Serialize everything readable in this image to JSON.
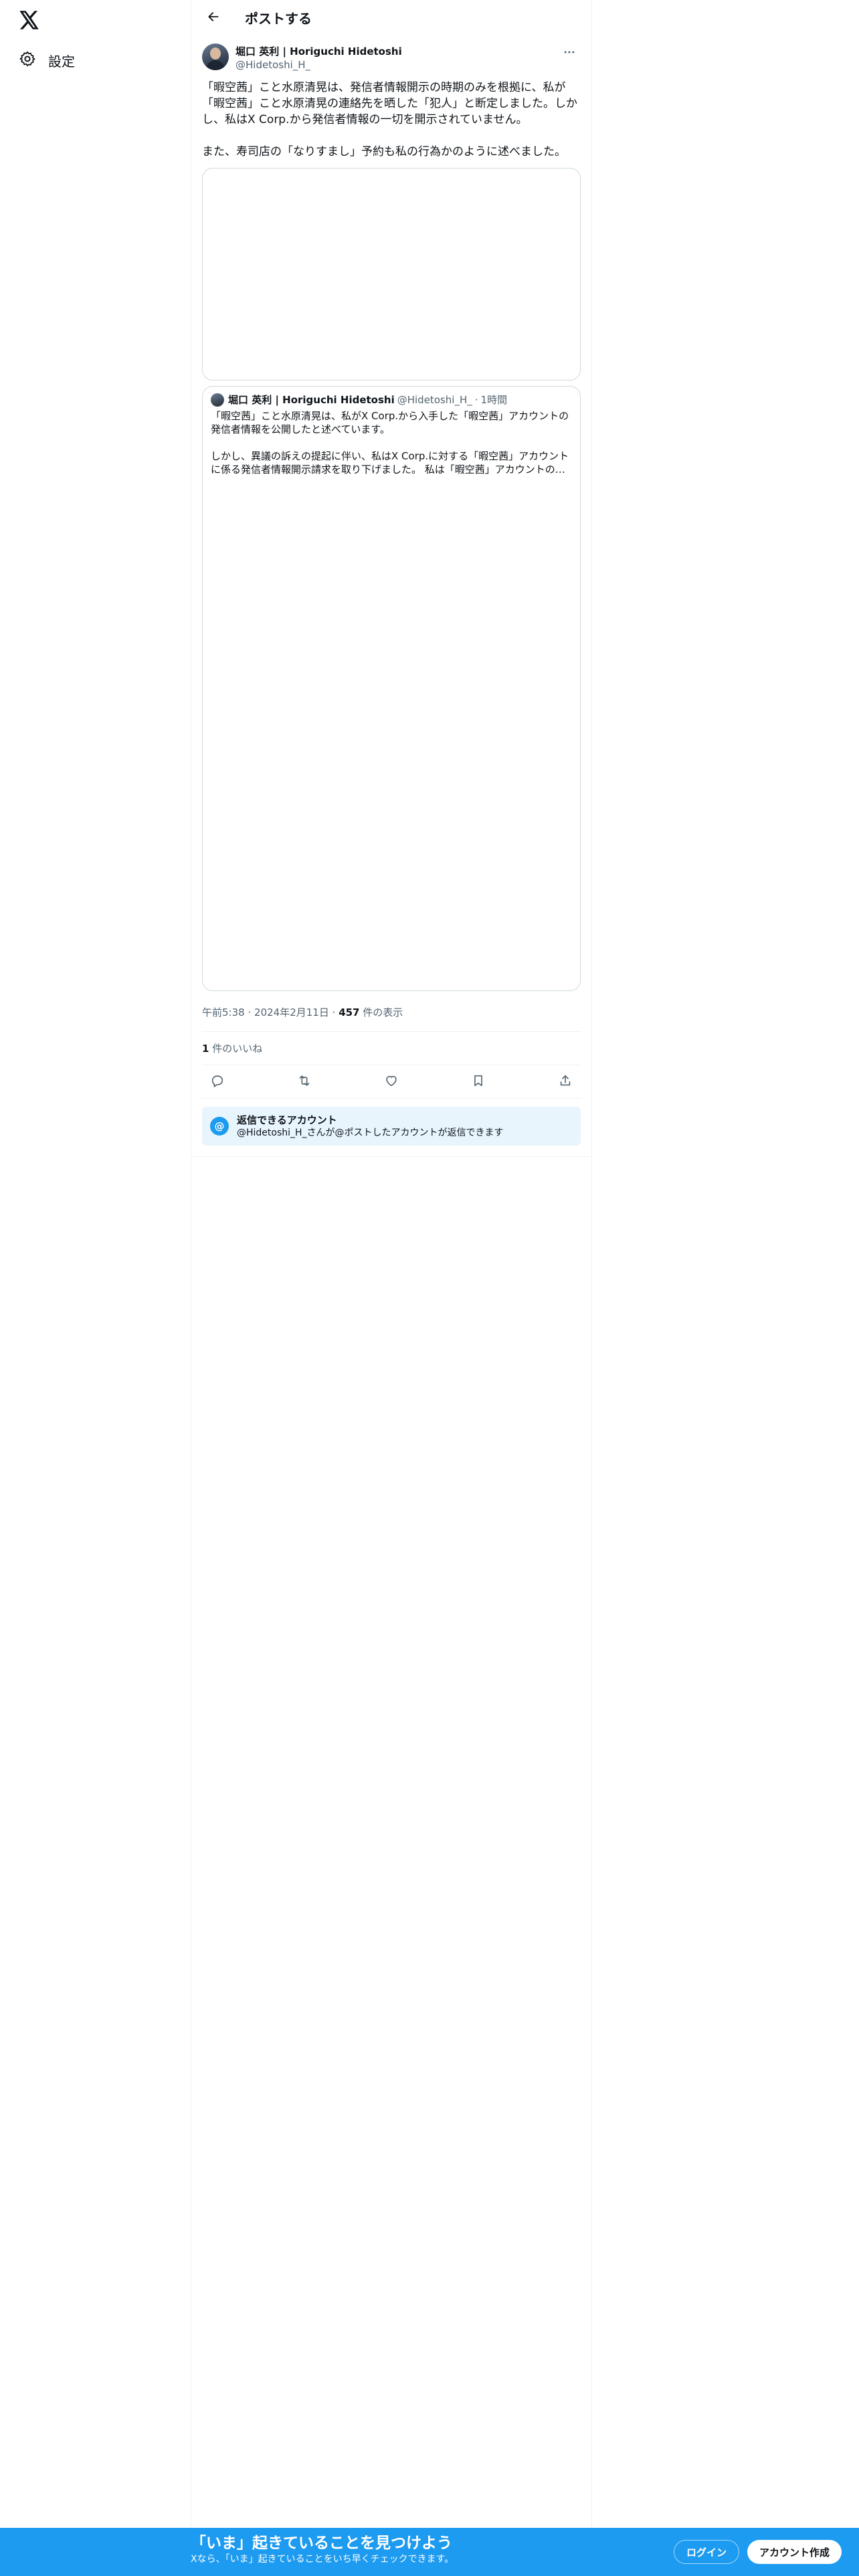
{
  "sidebar": {
    "logo_icon": "x-logo-icon",
    "settings_label": "設定",
    "settings_icon": "gear-icon"
  },
  "header": {
    "back_icon": "arrow-left-icon",
    "title": "ポストする"
  },
  "post": {
    "author_name": "堀口 英利 | Horiguchi Hidetoshi",
    "author_handle": "@Hidetoshi_H_",
    "more_icon": "more-horizontal-icon",
    "text": "「暇空茜」こと水原清晃は、発信者情報開示の時期のみを根拠に、私が「暇空茜」こと水原清晃の連絡先を晒した「犯人」と断定しました。しかし、私はX Corp.から発信者情報の一切を開示されていません。\n\nまた、寿司店の「なりすまし」予約も私の行為かのように述べました。",
    "quote": {
      "author_name": "堀口 英利 | Horiguchi Hidetoshi",
      "author_handle": "@Hidetoshi_H_",
      "separator": "·",
      "time": "1時間",
      "text": "「暇空茜」こと水原清晃は、私がX Corp.から入手した「暇空茜」アカウントの発信者情報を公開したと述べています。\n\nしかし、異議の訴えの提起に伴い、私はX Corp.に対する「暇空茜」アカウントに係る発信者情報開示請求を取り下げました。 私は「暇空茜」アカウントの…"
    },
    "meta": {
      "time": "午前5:38",
      "dot1": "·",
      "date": "2024年2月11日",
      "dot2": "·",
      "views_count": "457",
      "views_label": " 件の表示"
    },
    "likes": {
      "count": "1",
      "label": " 件のいいね"
    },
    "actions": {
      "reply_icon": "reply-icon",
      "repost_icon": "repost-icon",
      "like_icon": "heart-icon",
      "bookmark_icon": "bookmark-icon",
      "share_icon": "share-icon"
    },
    "reply_notice": {
      "icon": "at-icon",
      "icon_glyph": "@",
      "title": "返信できるアカウント",
      "desc": "@Hidetoshi_H_さんが@ポストしたアカウントが返信できます"
    }
  },
  "banner": {
    "title": "「いま」起きていることを見つけよう",
    "subtitle": "Xなら、「いま」起きていることをいち早くチェックできます。",
    "login_label": "ログイン",
    "signup_label": "アカウント作成",
    "background_color": "#1d9bf0"
  }
}
